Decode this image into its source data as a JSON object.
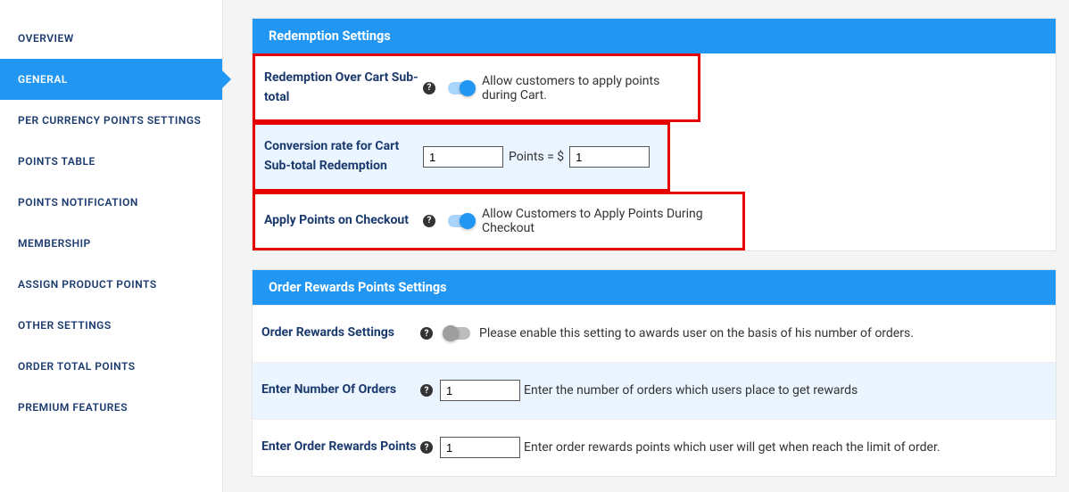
{
  "sidebar": {
    "items": [
      {
        "label": "OVERVIEW",
        "key": "overview"
      },
      {
        "label": "GENERAL",
        "key": "general"
      },
      {
        "label": "PER CURRENCY POINTS SETTINGS",
        "key": "per-currency"
      },
      {
        "label": "POINTS TABLE",
        "key": "points-table"
      },
      {
        "label": "POINTS NOTIFICATION",
        "key": "points-notification"
      },
      {
        "label": "MEMBERSHIP",
        "key": "membership"
      },
      {
        "label": "ASSIGN PRODUCT POINTS",
        "key": "assign-product"
      },
      {
        "label": "OTHER SETTINGS",
        "key": "other"
      },
      {
        "label": "ORDER TOTAL POINTS",
        "key": "order-total"
      },
      {
        "label": "PREMIUM FEATURES",
        "key": "premium"
      }
    ],
    "active_index": 1
  },
  "redemption": {
    "header": "Redemption Settings",
    "over_cart_label": "Redemption Over Cart Sub-total",
    "over_cart_desc": "Allow customers to apply points during Cart.",
    "over_cart_on": true,
    "conversion_label": "Conversion rate for Cart Sub-total Redemption",
    "conversion_points_value": "1",
    "conversion_middle": "Points = $",
    "conversion_dollar_value": "1",
    "apply_checkout_label": "Apply Points on Checkout",
    "apply_checkout_desc": "Allow Customers to Apply Points During Checkout",
    "apply_checkout_on": true
  },
  "order_rewards": {
    "header": "Order Rewards Points Settings",
    "enable_label": "Order Rewards Settings",
    "enable_desc": "Please enable this setting to awards user on the basis of his number of orders.",
    "enable_on": false,
    "num_orders_label": "Enter Number Of Orders",
    "num_orders_value": "1",
    "num_orders_desc": "Enter the number of orders which users place to get rewards",
    "reward_points_label": "Enter Order Rewards Points",
    "reward_points_value": "1",
    "reward_points_desc": "Enter order rewards points which user will get when reach the limit of order."
  }
}
